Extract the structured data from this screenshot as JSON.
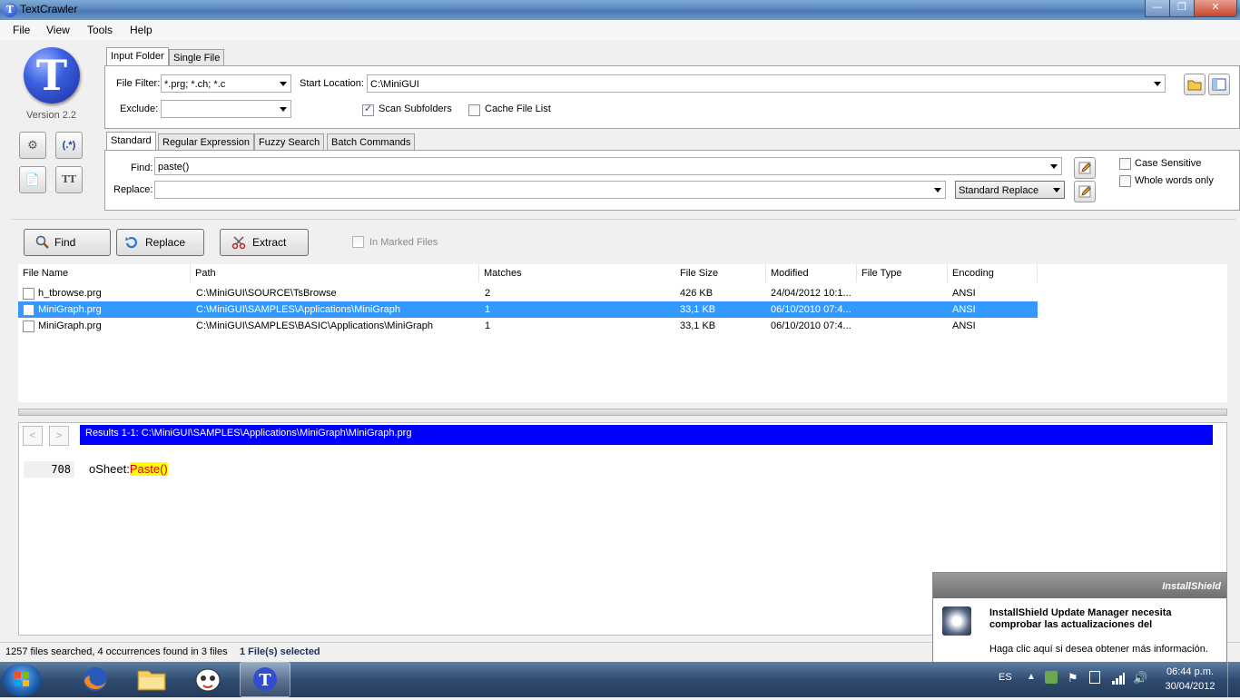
{
  "window": {
    "title": "TextCrawler",
    "controls": [
      "minimize",
      "maximize",
      "close"
    ]
  },
  "menu": [
    "File",
    "View",
    "Tools",
    "Help"
  ],
  "app": {
    "logo_letter": "T",
    "version": "Version 2.2",
    "left_toolbar": [
      "gear-icon",
      "regex-icon",
      "document-icon",
      "font-icon"
    ],
    "font_button_label": "TT",
    "regex_button_label": "(.*)"
  },
  "folder_tabs": [
    "Input Folder",
    "Single File"
  ],
  "input": {
    "file_filter_label": "File Filter:",
    "file_filter_value": "*.prg; *.ch; *.c",
    "exclude_label": "Exclude:",
    "exclude_value": "",
    "start_location_label": "Start Location:",
    "start_location_value": "C:\\MiniGUI",
    "scan_subfolders_label": "Scan Subfolders",
    "scan_subfolders_checked": true,
    "cache_file_list_label": "Cache File List",
    "cache_file_list_checked": false
  },
  "search_tabs": [
    "Standard",
    "Regular Expression",
    "Fuzzy Search",
    "Batch Commands"
  ],
  "search": {
    "find_label": "Find:",
    "find_value": "paste()",
    "replace_label": "Replace:",
    "replace_value": "",
    "replace_mode": "Standard Replace",
    "case_sensitive_label": "Case Sensitive",
    "whole_words_label": "Whole words only"
  },
  "actions": {
    "find": "Find",
    "replace": "Replace",
    "extract": "Extract",
    "in_marked_files": "In Marked Files"
  },
  "grid": {
    "columns": [
      "File Name",
      "Path",
      "Matches",
      "File Size",
      "Modified",
      "File Type",
      "Encoding"
    ],
    "rows": [
      {
        "name": "h_tbrowse.prg",
        "path": "C:\\MiniGUI\\SOURCE\\TsBrowse",
        "matches": "2",
        "size": "426 KB",
        "modified": "24/04/2012 10:1...",
        "type": "",
        "encoding": "ANSI",
        "selected": false
      },
      {
        "name": "MiniGraph.prg",
        "path": "C:\\MiniGUI\\SAMPLES\\Applications\\MiniGraph",
        "matches": "1",
        "size": "33,1 KB",
        "modified": "06/10/2010 07:4...",
        "type": "",
        "encoding": "ANSI",
        "selected": true
      },
      {
        "name": "MiniGraph.prg",
        "path": "C:\\MiniGUI\\SAMPLES\\BASIC\\Applications\\MiniGraph",
        "matches": "1",
        "size": "33,1 KB",
        "modified": "06/10/2010 07:4...",
        "type": "",
        "encoding": "ANSI",
        "selected": false
      }
    ]
  },
  "results": {
    "prev": "<",
    "next": ">",
    "header": "Results 1-1: C:\\MiniGUI\\SAMPLES\\Applications\\MiniGraph\\MiniGraph.prg",
    "line_number": "708",
    "line_prefix": "oSheet:",
    "line_match": "Paste()"
  },
  "status": {
    "summary": "1257 files searched, 4 occurrences found in 3 files",
    "selection": "1 File(s) selected"
  },
  "popup": {
    "brand": "InstallShield",
    "title": "InstallShield Update Manager necesita comprobar las actualizaciones del",
    "body": "Haga clic aquí si desea obtener más información."
  },
  "taskbar": {
    "apps": [
      "firefox-icon",
      "explorer-icon",
      "character-icon",
      "textcrawler-icon"
    ],
    "language": "ES",
    "time": "06:44 p.m.",
    "date": "30/04/2012"
  },
  "colors": {
    "selection": "#3399ff",
    "results_bar": "#0000ff",
    "highlight": "#ffff00"
  }
}
